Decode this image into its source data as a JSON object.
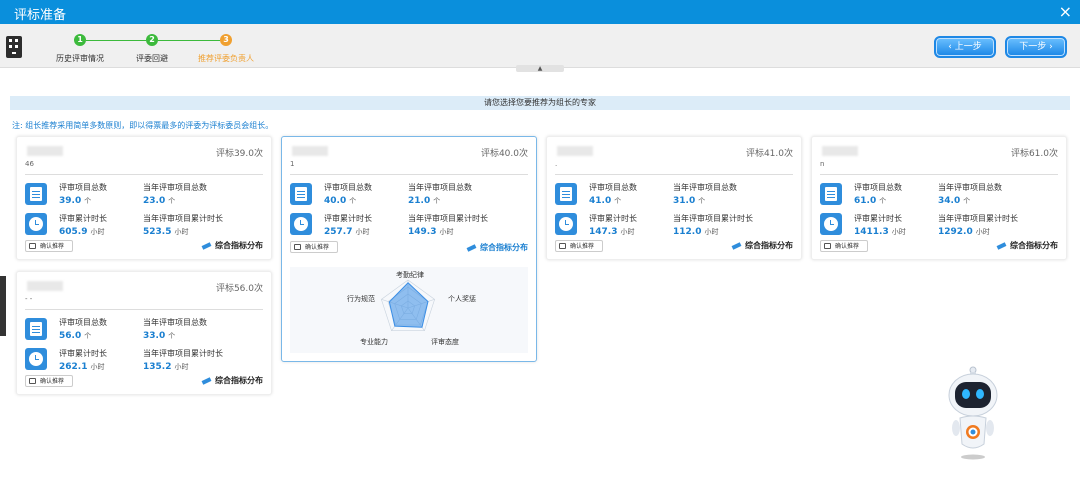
{
  "window": {
    "title": "评标准备",
    "close": "×"
  },
  "steps": [
    {
      "num": "1",
      "label": "历史评审情况",
      "state": "done",
      "color": "#3cba3c"
    },
    {
      "num": "2",
      "label": "评委回避",
      "state": "done",
      "color": "#3cba3c"
    },
    {
      "num": "3",
      "label": "推荐评委负责人",
      "state": "active",
      "color": "#f0a030"
    }
  ],
  "nav": {
    "prev": "上一步",
    "next": "下一步"
  },
  "banner": "请您选择您要推荐为组长的专家",
  "note": "注: 组长推荐采用简单多数原则，即以得票最多的评委为评标委员会组长。",
  "labels": {
    "total_projects": "评审项目总数",
    "year_projects": "当年评审项目总数",
    "total_hours": "评审累计时长",
    "year_hours": "当年评审项目累计时长",
    "unit_count": "个",
    "unit_hours": "小时",
    "confirm": "确认推荐",
    "distribution": "综合指标分布"
  },
  "experts": [
    {
      "code": "46",
      "count": "评标39.0次",
      "total_projects": "39.0",
      "year_projects": "23.0",
      "total_hours": "605.9",
      "year_hours": "523.5",
      "selected": false
    },
    {
      "code": "1",
      "count": "评标40.0次",
      "total_projects": "40.0",
      "year_projects": "21.0",
      "total_hours": "257.7",
      "year_hours": "149.3",
      "selected": true
    },
    {
      "code": ".",
      "count": "评标41.0次",
      "total_projects": "41.0",
      "year_projects": "31.0",
      "total_hours": "147.3",
      "year_hours": "112.0",
      "selected": false
    },
    {
      "code": "n",
      "count": "评标61.0次",
      "total_projects": "61.0",
      "year_projects": "34.0",
      "total_hours": "1411.3",
      "year_hours": "1292.0",
      "selected": false
    },
    {
      "code": "- -",
      "count": "评标56.0次",
      "total_projects": "56.0",
      "year_projects": "33.0",
      "total_hours": "262.1",
      "year_hours": "135.2",
      "selected": false
    }
  ],
  "radar": {
    "axes": [
      "考勤纪律",
      "个人奖惩",
      "评审态度",
      "专业能力",
      "行为规范"
    ],
    "values": [
      0.9,
      0.75,
      0.85,
      0.8,
      0.7
    ],
    "color": "#3a8ee6"
  }
}
